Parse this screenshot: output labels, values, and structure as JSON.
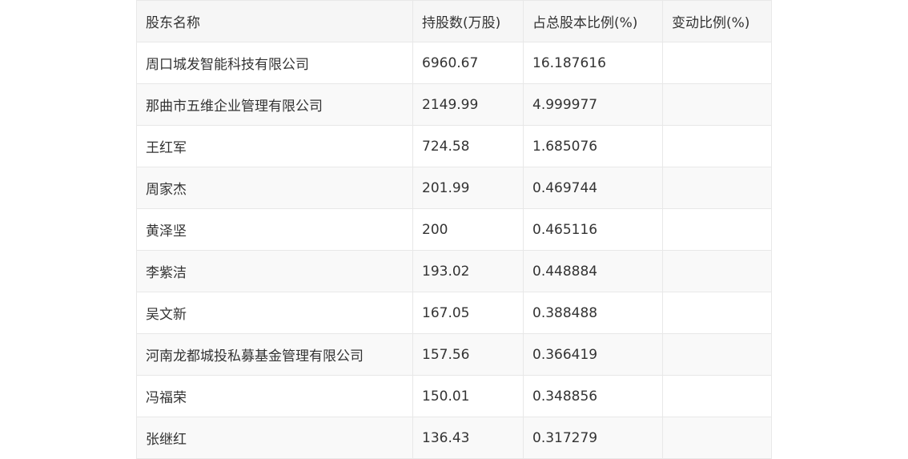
{
  "table": {
    "headers": [
      "股东名称",
      "持股数(万股)",
      "占总股本比例(%)",
      "变动比例(%)"
    ],
    "rows": [
      [
        "周口城发智能科技有限公司",
        "6960.67",
        "16.187616",
        ""
      ],
      [
        "那曲市五维企业管理有限公司",
        "2149.99",
        "4.999977",
        ""
      ],
      [
        "王红军",
        "724.58",
        "1.685076",
        ""
      ],
      [
        "周家杰",
        "201.99",
        "0.469744",
        ""
      ],
      [
        "黄泽坚",
        "200",
        "0.465116",
        ""
      ],
      [
        "李紫洁",
        "193.02",
        "0.448884",
        ""
      ],
      [
        "吴文新",
        "167.05",
        "0.388488",
        ""
      ],
      [
        "河南龙都城投私募基金管理有限公司",
        "157.56",
        "0.366419",
        ""
      ],
      [
        "冯福荣",
        "150.01",
        "0.348856",
        ""
      ],
      [
        "张继红",
        "136.43",
        "0.317279",
        ""
      ]
    ]
  }
}
